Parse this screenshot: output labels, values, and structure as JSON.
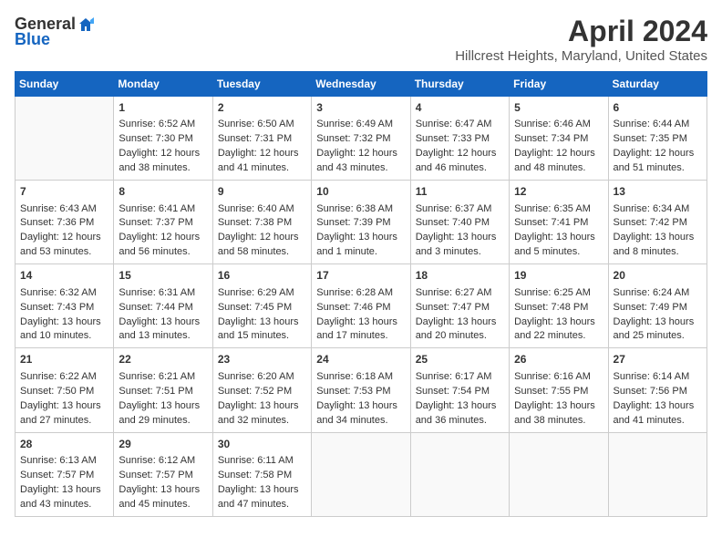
{
  "header": {
    "logo_general": "General",
    "logo_blue": "Blue",
    "title": "April 2024",
    "location": "Hillcrest Heights, Maryland, United States"
  },
  "days_of_week": [
    "Sunday",
    "Monday",
    "Tuesday",
    "Wednesday",
    "Thursday",
    "Friday",
    "Saturday"
  ],
  "weeks": [
    [
      {
        "day": "",
        "sunrise": "",
        "sunset": "",
        "daylight": "",
        "empty": true
      },
      {
        "day": "1",
        "sunrise": "Sunrise: 6:52 AM",
        "sunset": "Sunset: 7:30 PM",
        "daylight": "Daylight: 12 hours and 38 minutes.",
        "empty": false
      },
      {
        "day": "2",
        "sunrise": "Sunrise: 6:50 AM",
        "sunset": "Sunset: 7:31 PM",
        "daylight": "Daylight: 12 hours and 41 minutes.",
        "empty": false
      },
      {
        "day": "3",
        "sunrise": "Sunrise: 6:49 AM",
        "sunset": "Sunset: 7:32 PM",
        "daylight": "Daylight: 12 hours and 43 minutes.",
        "empty": false
      },
      {
        "day": "4",
        "sunrise": "Sunrise: 6:47 AM",
        "sunset": "Sunset: 7:33 PM",
        "daylight": "Daylight: 12 hours and 46 minutes.",
        "empty": false
      },
      {
        "day": "5",
        "sunrise": "Sunrise: 6:46 AM",
        "sunset": "Sunset: 7:34 PM",
        "daylight": "Daylight: 12 hours and 48 minutes.",
        "empty": false
      },
      {
        "day": "6",
        "sunrise": "Sunrise: 6:44 AM",
        "sunset": "Sunset: 7:35 PM",
        "daylight": "Daylight: 12 hours and 51 minutes.",
        "empty": false
      }
    ],
    [
      {
        "day": "7",
        "sunrise": "Sunrise: 6:43 AM",
        "sunset": "Sunset: 7:36 PM",
        "daylight": "Daylight: 12 hours and 53 minutes.",
        "empty": false
      },
      {
        "day": "8",
        "sunrise": "Sunrise: 6:41 AM",
        "sunset": "Sunset: 7:37 PM",
        "daylight": "Daylight: 12 hours and 56 minutes.",
        "empty": false
      },
      {
        "day": "9",
        "sunrise": "Sunrise: 6:40 AM",
        "sunset": "Sunset: 7:38 PM",
        "daylight": "Daylight: 12 hours and 58 minutes.",
        "empty": false
      },
      {
        "day": "10",
        "sunrise": "Sunrise: 6:38 AM",
        "sunset": "Sunset: 7:39 PM",
        "daylight": "Daylight: 13 hours and 1 minute.",
        "empty": false
      },
      {
        "day": "11",
        "sunrise": "Sunrise: 6:37 AM",
        "sunset": "Sunset: 7:40 PM",
        "daylight": "Daylight: 13 hours and 3 minutes.",
        "empty": false
      },
      {
        "day": "12",
        "sunrise": "Sunrise: 6:35 AM",
        "sunset": "Sunset: 7:41 PM",
        "daylight": "Daylight: 13 hours and 5 minutes.",
        "empty": false
      },
      {
        "day": "13",
        "sunrise": "Sunrise: 6:34 AM",
        "sunset": "Sunset: 7:42 PM",
        "daylight": "Daylight: 13 hours and 8 minutes.",
        "empty": false
      }
    ],
    [
      {
        "day": "14",
        "sunrise": "Sunrise: 6:32 AM",
        "sunset": "Sunset: 7:43 PM",
        "daylight": "Daylight: 13 hours and 10 minutes.",
        "empty": false
      },
      {
        "day": "15",
        "sunrise": "Sunrise: 6:31 AM",
        "sunset": "Sunset: 7:44 PM",
        "daylight": "Daylight: 13 hours and 13 minutes.",
        "empty": false
      },
      {
        "day": "16",
        "sunrise": "Sunrise: 6:29 AM",
        "sunset": "Sunset: 7:45 PM",
        "daylight": "Daylight: 13 hours and 15 minutes.",
        "empty": false
      },
      {
        "day": "17",
        "sunrise": "Sunrise: 6:28 AM",
        "sunset": "Sunset: 7:46 PM",
        "daylight": "Daylight: 13 hours and 17 minutes.",
        "empty": false
      },
      {
        "day": "18",
        "sunrise": "Sunrise: 6:27 AM",
        "sunset": "Sunset: 7:47 PM",
        "daylight": "Daylight: 13 hours and 20 minutes.",
        "empty": false
      },
      {
        "day": "19",
        "sunrise": "Sunrise: 6:25 AM",
        "sunset": "Sunset: 7:48 PM",
        "daylight": "Daylight: 13 hours and 22 minutes.",
        "empty": false
      },
      {
        "day": "20",
        "sunrise": "Sunrise: 6:24 AM",
        "sunset": "Sunset: 7:49 PM",
        "daylight": "Daylight: 13 hours and 25 minutes.",
        "empty": false
      }
    ],
    [
      {
        "day": "21",
        "sunrise": "Sunrise: 6:22 AM",
        "sunset": "Sunset: 7:50 PM",
        "daylight": "Daylight: 13 hours and 27 minutes.",
        "empty": false
      },
      {
        "day": "22",
        "sunrise": "Sunrise: 6:21 AM",
        "sunset": "Sunset: 7:51 PM",
        "daylight": "Daylight: 13 hours and 29 minutes.",
        "empty": false
      },
      {
        "day": "23",
        "sunrise": "Sunrise: 6:20 AM",
        "sunset": "Sunset: 7:52 PM",
        "daylight": "Daylight: 13 hours and 32 minutes.",
        "empty": false
      },
      {
        "day": "24",
        "sunrise": "Sunrise: 6:18 AM",
        "sunset": "Sunset: 7:53 PM",
        "daylight": "Daylight: 13 hours and 34 minutes.",
        "empty": false
      },
      {
        "day": "25",
        "sunrise": "Sunrise: 6:17 AM",
        "sunset": "Sunset: 7:54 PM",
        "daylight": "Daylight: 13 hours and 36 minutes.",
        "empty": false
      },
      {
        "day": "26",
        "sunrise": "Sunrise: 6:16 AM",
        "sunset": "Sunset: 7:55 PM",
        "daylight": "Daylight: 13 hours and 38 minutes.",
        "empty": false
      },
      {
        "day": "27",
        "sunrise": "Sunrise: 6:14 AM",
        "sunset": "Sunset: 7:56 PM",
        "daylight": "Daylight: 13 hours and 41 minutes.",
        "empty": false
      }
    ],
    [
      {
        "day": "28",
        "sunrise": "Sunrise: 6:13 AM",
        "sunset": "Sunset: 7:57 PM",
        "daylight": "Daylight: 13 hours and 43 minutes.",
        "empty": false
      },
      {
        "day": "29",
        "sunrise": "Sunrise: 6:12 AM",
        "sunset": "Sunset: 7:57 PM",
        "daylight": "Daylight: 13 hours and 45 minutes.",
        "empty": false
      },
      {
        "day": "30",
        "sunrise": "Sunrise: 6:11 AM",
        "sunset": "Sunset: 7:58 PM",
        "daylight": "Daylight: 13 hours and 47 minutes.",
        "empty": false
      },
      {
        "day": "",
        "sunrise": "",
        "sunset": "",
        "daylight": "",
        "empty": true
      },
      {
        "day": "",
        "sunrise": "",
        "sunset": "",
        "daylight": "",
        "empty": true
      },
      {
        "day": "",
        "sunrise": "",
        "sunset": "",
        "daylight": "",
        "empty": true
      },
      {
        "day": "",
        "sunrise": "",
        "sunset": "",
        "daylight": "",
        "empty": true
      }
    ]
  ]
}
